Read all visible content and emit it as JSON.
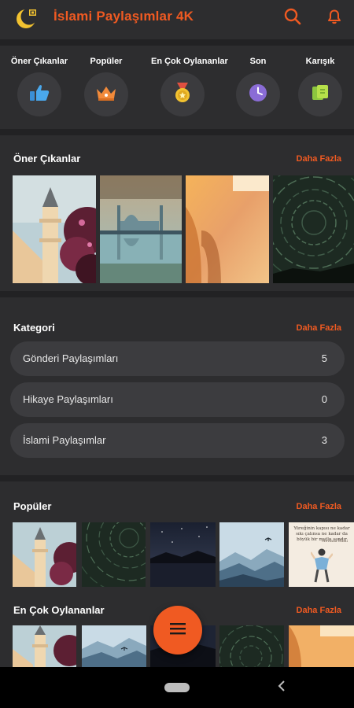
{
  "app": {
    "title": "İslami Paylaşımlar 4K",
    "logo_icon": "crescent-star-icon",
    "search_icon": "search-icon",
    "notification_icon": "bell-icon",
    "accent": "#f05a22"
  },
  "quick_nav": [
    {
      "label": "Öner Çıkanlar",
      "icon": "thumbs-up-icon"
    },
    {
      "label": "Popüler",
      "icon": "crown-icon"
    },
    {
      "label": "En Çok Oylananlar",
      "icon": "medal-icon"
    },
    {
      "label": "Son",
      "icon": "clock-icon"
    },
    {
      "label": "Karışık",
      "icon": "shuffle-icon"
    }
  ],
  "featured": {
    "title": "Öner Çıkanlar",
    "more": "Daha Fazla"
  },
  "category": {
    "title": "Kategori",
    "more": "Daha Fazla",
    "items": [
      {
        "label": "Gönderi Paylaşımları",
        "count": "5"
      },
      {
        "label": "Hikaye Paylaşımları",
        "count": "0"
      },
      {
        "label": "İslami Paylaşımlar",
        "count": "3"
      }
    ]
  },
  "popular": {
    "title": "Popüler",
    "more": "Daha Fazla",
    "quote_text": "Yüreğinin kapısı ne kadar sıkı çalınsa ne kadar da böyük bir mutlu sandır",
    "quote_author": "Mevlana Rûmi"
  },
  "most_voted": {
    "title": "En Çok Oylananlar",
    "more": "Daha Fazla"
  },
  "fab_icon": "menu-icon",
  "nav": {
    "home_icon": "home-pill-icon",
    "back_icon": "back-icon"
  }
}
